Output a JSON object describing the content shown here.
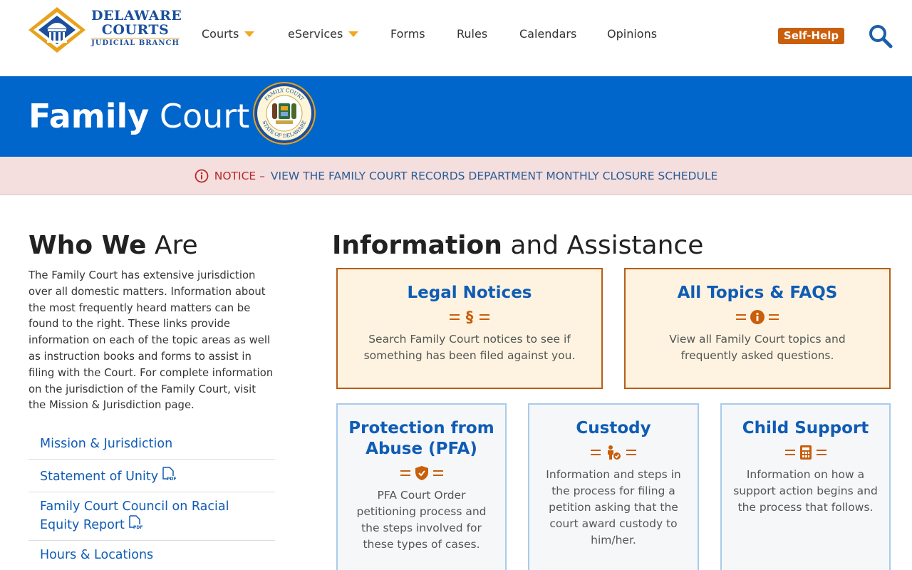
{
  "logo": {
    "line1": "DELAWARE",
    "line2": "COURTS",
    "line3": "JUDICIAL BRANCH"
  },
  "nav": [
    {
      "label": "Courts",
      "dropdown": true
    },
    {
      "label": "eServices",
      "dropdown": true
    },
    {
      "label": "Forms",
      "dropdown": false
    },
    {
      "label": "Rules",
      "dropdown": false
    },
    {
      "label": "Calendars",
      "dropdown": false
    },
    {
      "label": "Opinions",
      "dropdown": false
    }
  ],
  "self_help": "Self-Help",
  "banner": {
    "title_bold": "Family",
    "title_light": "Court",
    "seal_top": "FAMILY COURT",
    "seal_bottom": "STATE OF DELAWARE"
  },
  "notice": {
    "label": "NOTICE",
    "separator": "–",
    "link": "VIEW THE FAMILY COURT RECORDS DEPARTMENT MONTHLY CLOSURE SCHEDULE"
  },
  "who": {
    "heading_bold": "Who We",
    "heading_light": "Are",
    "text": "The Family Court has extensive jurisdiction over all domestic matters. Information about the most frequently heard matters can be found to the right. These links provide information on each of the topic areas as well as instruction books and forms to assist in filing with the Court. For complete information on the jurisdiction of the Family Court, visit the Mission & Jurisdiction page.",
    "links": [
      {
        "label": "Mission & Jurisdiction",
        "pdf": false
      },
      {
        "label": "Statement of Unity",
        "pdf": true
      },
      {
        "label": "Family Court Council on Racial Equity Report",
        "pdf": true
      },
      {
        "label": "Hours & Locations",
        "pdf": false
      }
    ]
  },
  "info": {
    "heading_bold": "Information",
    "heading_light": "and Assistance",
    "cards": [
      {
        "title": "Legal Notices",
        "icon": "section-icon",
        "desc": "Search Family Court notices to see if something has been filed against you."
      },
      {
        "title": "All Topics & FAQS",
        "icon": "info-icon",
        "desc": "View all Family Court topics and frequently asked questions."
      },
      {
        "title": "Protection from Abuse (PFA)",
        "icon": "shield-check-icon",
        "desc": "PFA Court Order petitioning process and the steps involved for these types of cases."
      },
      {
        "title": "Custody",
        "icon": "child-check-icon",
        "desc": "Information and steps in the process for filing a petition asking that the court award custody to him/her."
      },
      {
        "title": "Child Support",
        "icon": "calculator-icon",
        "desc": "Information on how a support action begins and the process that follows."
      }
    ]
  },
  "colors": {
    "brand_blue": "#0066cc",
    "accent_orange": "#c95e0b",
    "link_blue": "#0f5cb5",
    "notice_bg": "#f4dede"
  }
}
